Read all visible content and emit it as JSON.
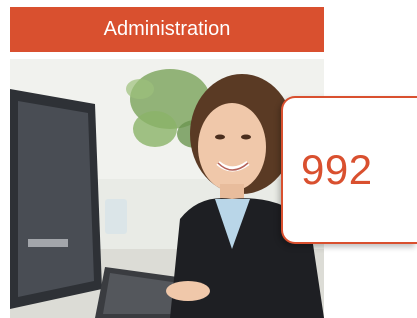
{
  "banner": {
    "title": "Administration"
  },
  "stat": {
    "value": "992"
  },
  "photo": {
    "subject": "woman smiling at computer workstation"
  },
  "colors": {
    "accent": "#d9502f",
    "banner_bg": "#d9502f",
    "text_light": "#ffffff"
  }
}
